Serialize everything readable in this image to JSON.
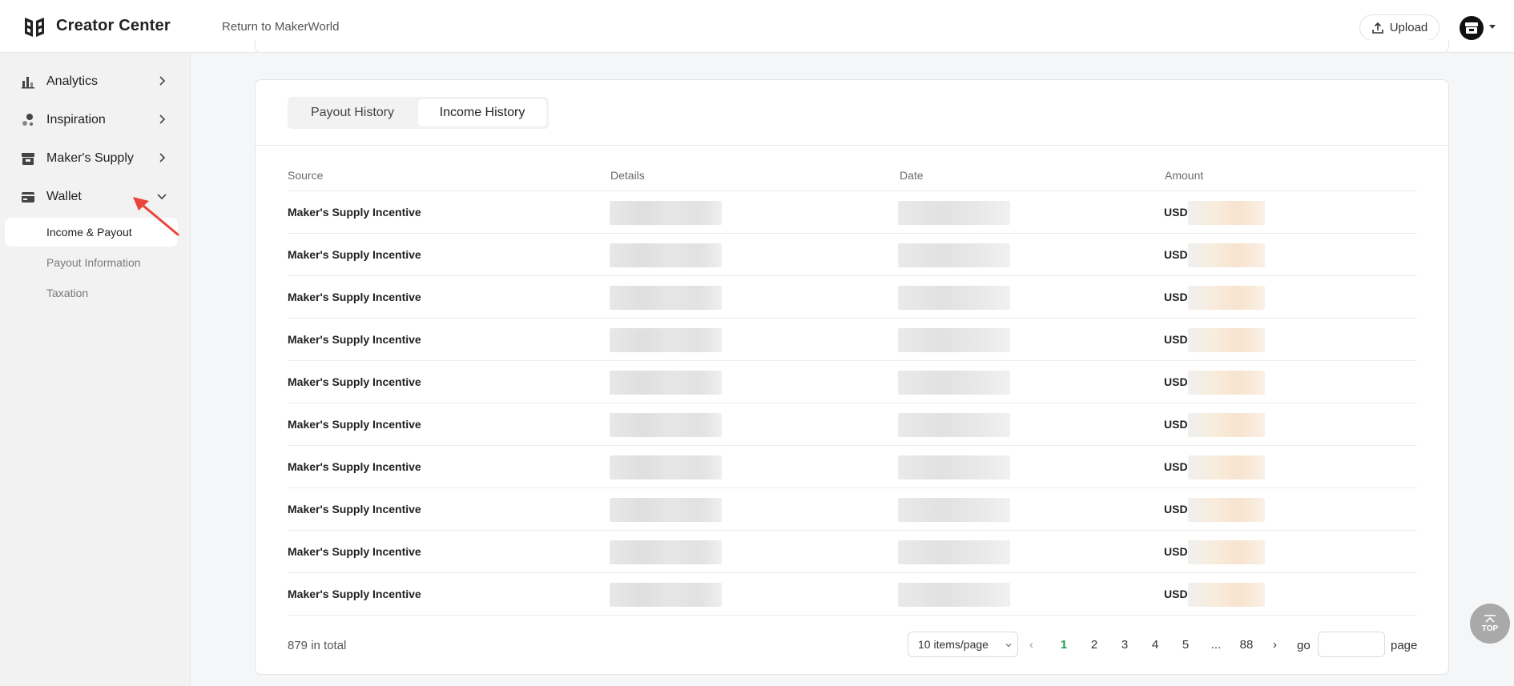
{
  "header": {
    "brand": "Creator Center",
    "return_link": "Return to MakerWorld",
    "upload_label": "Upload"
  },
  "sidebar": {
    "items": [
      {
        "label": "Analytics",
        "icon": "bar-chart-icon"
      },
      {
        "label": "Inspiration",
        "icon": "bubbles-icon"
      },
      {
        "label": "Maker's Supply",
        "icon": "store-icon"
      },
      {
        "label": "Wallet",
        "icon": "wallet-icon",
        "expanded": true
      }
    ],
    "wallet_sub": [
      {
        "label": "Income & Payout",
        "active": true
      },
      {
        "label": "Payout Information",
        "active": false
      },
      {
        "label": "Taxation",
        "active": false
      }
    ]
  },
  "tabs": [
    {
      "label": "Payout History",
      "active": false
    },
    {
      "label": "Income History",
      "active": true
    }
  ],
  "table": {
    "columns": [
      "Source",
      "Details",
      "Date",
      "Amount"
    ],
    "rows": [
      {
        "source": "Maker's Supply Incentive",
        "currency": "USD"
      },
      {
        "source": "Maker's Supply Incentive",
        "currency": "USD"
      },
      {
        "source": "Maker's Supply Incentive",
        "currency": "USD"
      },
      {
        "source": "Maker's Supply Incentive",
        "currency": "USD"
      },
      {
        "source": "Maker's Supply Incentive",
        "currency": "USD"
      },
      {
        "source": "Maker's Supply Incentive",
        "currency": "USD"
      },
      {
        "source": "Maker's Supply Incentive",
        "currency": "USD"
      },
      {
        "source": "Maker's Supply Incentive",
        "currency": "USD"
      },
      {
        "source": "Maker's Supply Incentive",
        "currency": "USD"
      },
      {
        "source": "Maker's Supply Incentive",
        "currency": "USD"
      }
    ]
  },
  "pagination": {
    "total_text": "879 in total",
    "page_size": "10 items/page",
    "prev": "‹",
    "next": "›",
    "pages": [
      "1",
      "2",
      "3",
      "4",
      "5",
      "...",
      "88"
    ],
    "current_page": "1",
    "go_label": "go",
    "page_label": "page"
  },
  "back_to_top": "TOP",
  "colors": {
    "accent_green": "#1a9e4b",
    "annotation_arrow": "#e8453c"
  }
}
